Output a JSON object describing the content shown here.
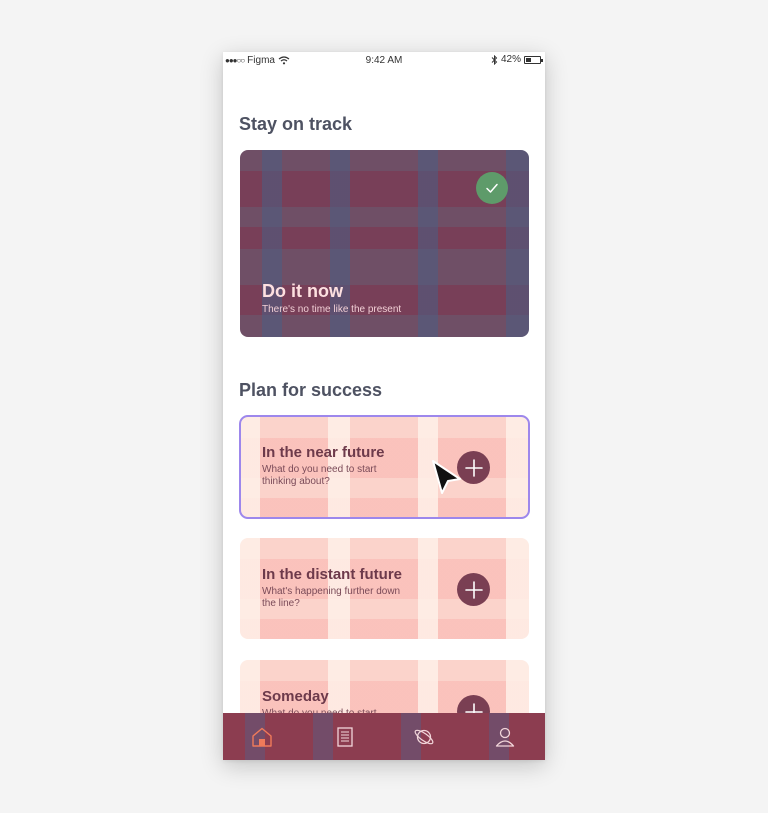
{
  "status_bar": {
    "carrier": "Figma",
    "time": "9:42 AM",
    "battery": "42%",
    "battery_level": 0.42
  },
  "sections": {
    "track_heading": "Stay on track",
    "plan_heading": "Plan for success"
  },
  "cards": {
    "now": {
      "title": "Do it now",
      "subtitle": "There's no time like the present",
      "completed": true
    },
    "near": {
      "title": "In the near future",
      "subtitle": "What do you need to start thinking about?"
    },
    "distant": {
      "title": "In the distant future",
      "subtitle": "What's happening further down the line?"
    },
    "someday": {
      "title": "Someday",
      "subtitle": "What do you need to start thinking about?"
    }
  },
  "tabs": [
    "home-icon",
    "list-icon",
    "planet-icon",
    "profile-icon"
  ],
  "colors": {
    "accent_green": "#5e9b6a",
    "plum": "#7a3f53",
    "selection": "#9d87ec",
    "heading": "#4e5262",
    "tab_active": "#f07a5a",
    "tab_inactive": "#f2d6da"
  }
}
